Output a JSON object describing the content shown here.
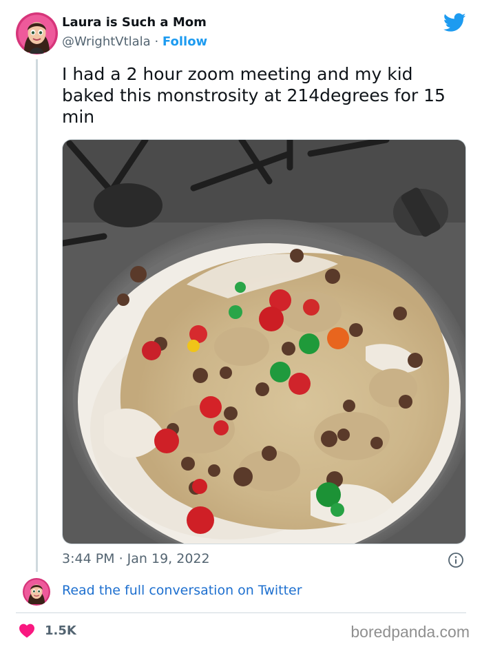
{
  "author": {
    "display_name": "Laura is Such a Mom",
    "handle": "@WrightVtlala",
    "separator": "·",
    "follow_label": "Follow"
  },
  "tweet": {
    "text": "I had a 2 hour zoom meeting and my kid baked this monstrosity at 214degrees for 15 min",
    "timestamp": "3:44 PM · Jan 19, 2022"
  },
  "read_more": {
    "label": "Read the full conversation on Twitter"
  },
  "likes": {
    "count": "1.5K"
  },
  "watermark": "boredpanda.com",
  "icons": {
    "brand": "twitter-bird-icon",
    "info": "info-icon",
    "like": "heart-icon"
  },
  "colors": {
    "twitter_blue": "#1d9bf0",
    "link_blue": "#1d6fcf",
    "heart": "#f91880",
    "muted": "#536471"
  }
}
